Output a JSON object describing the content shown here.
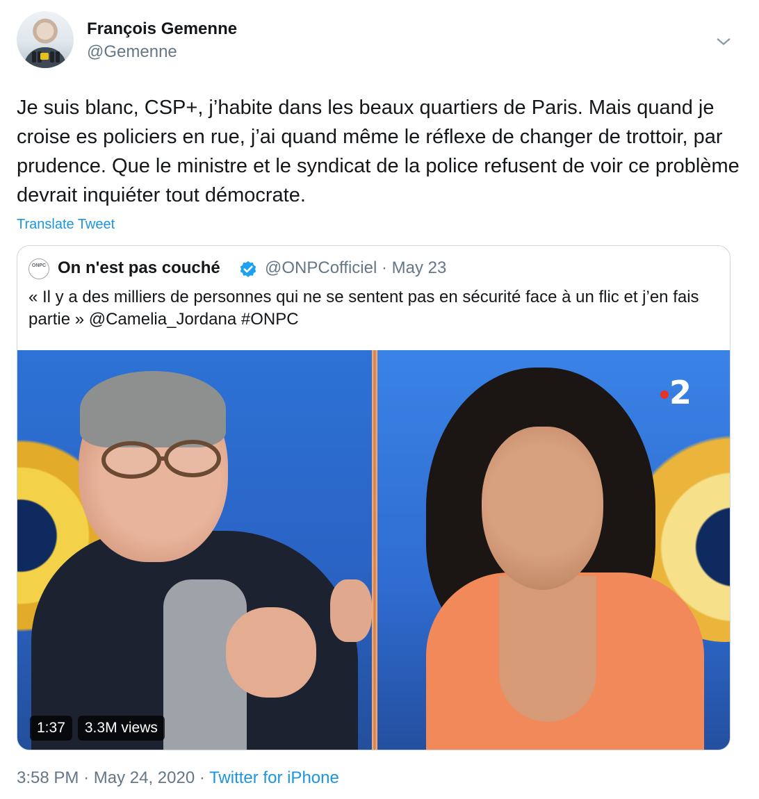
{
  "author": {
    "name": "François Gemenne",
    "handle": "@Gemenne"
  },
  "tweet": {
    "text": "Je suis blanc, CSP+, j’habite dans les beaux quartiers de Paris. Mais quand je croise es policiers en rue, j’ai quand même le réflexe de changer de trottoir, par prudence. Que le ministre et le syndicat de la police refusent de voir ce problème devrait inquiéter tout démocrate.",
    "translate_label": "Translate Tweet"
  },
  "quoted": {
    "avatar_text": "ONPC",
    "name": "On n'est pas couché",
    "handle": "@ONPCofficiel",
    "separator": "·",
    "date": "May 23",
    "text": "« Il y a des milliers de personnes qui ne se sentent pas en sécurité face à un flic et j’en fais partie » @Camelia_Jordana #ONPC",
    "media": {
      "channel_logo": "2",
      "duration": "1:37",
      "views": "3.3M views"
    }
  },
  "footer": {
    "time": "3:58 PM",
    "date": "May 24, 2020",
    "separator": "·",
    "source": "Twitter for iPhone"
  },
  "colors": {
    "link": "#1b95e0",
    "secondary_text": "#657786",
    "verified": "#1da1f2"
  },
  "icons": {
    "caret": "chevron-down-icon",
    "verified": "verified-badge-icon"
  }
}
